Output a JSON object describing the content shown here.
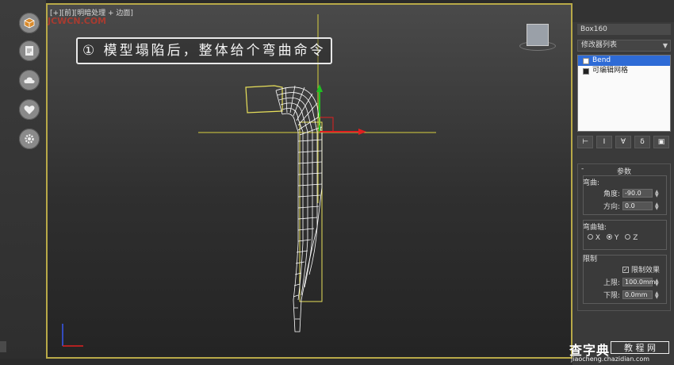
{
  "viewport": {
    "label": "[+][前][明暗处理 + 边面]",
    "watermark": "JCWCN.COM",
    "caption": "① 模型塌陷后，整体给个弯曲命令"
  },
  "side_icons": [
    "box-icon",
    "document-icon",
    "cloud-icon",
    "heart-icon",
    "gear-icon"
  ],
  "panel": {
    "object_name": "Box160",
    "modifier_list": "修改器列表",
    "stack": [
      {
        "label": "Bend",
        "selected": true
      },
      {
        "label": "可编辑网格",
        "selected": false
      }
    ],
    "rollout_title": "参数",
    "bend": {
      "group_label": "弯曲:",
      "angle_label": "角度:",
      "angle_value": "-90.0",
      "direction_label": "方向:",
      "direction_value": "0.0"
    },
    "axis": {
      "group_label": "弯曲轴:",
      "options": [
        "X",
        "Y",
        "Z"
      ],
      "selected": "Y"
    },
    "limits": {
      "group_label": "限制",
      "limit_effect_label": "限制效果",
      "limit_effect_checked": true,
      "upper_label": "上限:",
      "upper_value": "100.0mm",
      "lower_label": "下限:",
      "lower_value": "0.0mm"
    }
  },
  "logo": {
    "main": "查字典",
    "box": "教 程 网",
    "url": "jiaocheng.chazidian.com"
  },
  "colors": {
    "viewport_border": "#b8a948",
    "selection_blue": "#2e6bd6",
    "gizmo_red": "#e02020",
    "gizmo_green": "#20c020",
    "mesh_wire": "#ffffff",
    "bound_box": "#e8e05a"
  }
}
